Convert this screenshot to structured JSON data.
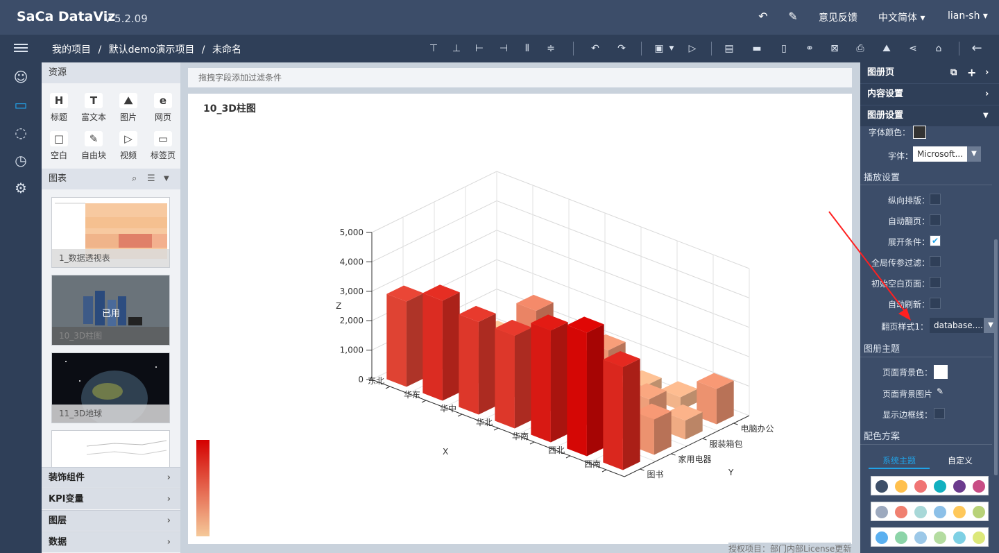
{
  "app": {
    "brand": "SaCa DataViz",
    "version": "V 5.2.09",
    "feedback": "意见反馈",
    "language": "中文简体 ▾",
    "user": "lian-sh ▾"
  },
  "toolbar": {
    "breadcrumb": [
      "我的项目",
      "/",
      "默认demo演示项目",
      "/",
      "未命名"
    ]
  },
  "left_panel": {
    "resources_title": "资源",
    "resources": [
      {
        "icon": "H",
        "label": "标题"
      },
      {
        "icon": "T",
        "label": "富文本"
      },
      {
        "icon": "⛰",
        "label": "图片"
      },
      {
        "icon": "e",
        "label": "网页"
      },
      {
        "icon": "□",
        "label": "空白"
      },
      {
        "icon": "✎",
        "label": "自由块"
      },
      {
        "icon": "▷",
        "label": "视频"
      },
      {
        "icon": "▭",
        "label": "标签页"
      }
    ],
    "charts_title": "图表",
    "thumbnails": [
      {
        "label": "1_数据透视表"
      },
      {
        "label": "10_3D柱图",
        "used_badge": "已用"
      },
      {
        "label": "11_3D地球"
      },
      {
        "label": ""
      }
    ],
    "bottom_sections": [
      "装饰组件",
      "KPI变量",
      "图层",
      "数据"
    ]
  },
  "canvas": {
    "filter_hint": "拖拽字段添加过滤条件",
    "chart_title": "10_3D柱图",
    "license": "授权项目：部门内部License更新"
  },
  "chart_data": {
    "type": "bar3d",
    "zlabel": "Z",
    "xlabel": "X",
    "ylabel": "Y",
    "z_ticks": [
      "5,000",
      "4,000",
      "3,000",
      "2,000",
      "1,000",
      "0"
    ],
    "x_categories": [
      "东北",
      "华东",
      "华中",
      "华北",
      "华南",
      "西北",
      "西南"
    ],
    "y_categories": [
      "电脑办公",
      "服装箱包",
      "家用电器",
      "图书"
    ],
    "zlim": [
      0,
      5000
    ],
    "color_min": "#f5c99a",
    "color_max": "#d40000",
    "values": [
      [
        2900,
        3400,
        3150,
        3150,
        3800,
        4200,
        3500
      ],
      [
        650,
        1200,
        2000,
        2350,
        2150,
        1400,
        1200
      ],
      [
        450,
        650,
        750,
        800,
        600,
        900,
        650
      ],
      [
        150,
        1500,
        300,
        1100,
        350,
        450,
        1200
      ]
    ]
  },
  "right_panel": {
    "sections": {
      "album": "图册页",
      "content": "内容设置",
      "album_settings": "图册设置"
    },
    "font_color_label": "字体颜色：",
    "font_label": "字体：",
    "font_value": "Microsoft...",
    "play_title": "播放设置",
    "play_options": [
      {
        "label": "纵向排版：",
        "checked": false
      },
      {
        "label": "自动翻页：",
        "checked": false
      },
      {
        "label": "展开条件：",
        "checked": true
      },
      {
        "label": "全局传参过滤：",
        "checked": false
      },
      {
        "label": "初始空白页面：",
        "checked": false
      },
      {
        "label": "自动刷新：",
        "checked": false
      }
    ],
    "page_style_label": "翻页样式1：",
    "page_style_value": "database....",
    "theme_title": "图册主题",
    "bg_color_label": "页面背景色：",
    "bg_image_label": "页面背景图片",
    "border_label": "显示边框线：",
    "color_scheme_title": "配色方案",
    "tab_system": "系统主题",
    "tab_custom": "自定义",
    "palettes": [
      [
        "#3d4f68",
        "#ffc04d",
        "#f07474",
        "#11b0c0",
        "#6b3b8e",
        "#c84d85"
      ],
      [
        "#9ca9be",
        "#f08070",
        "#a8d8d8",
        "#8cc0e8",
        "#ffc85a",
        "#b8d278"
      ],
      [
        "#5ab0f0",
        "#8cd4a8",
        "#9cc8e8",
        "#b4dca0",
        "#7ed0e4",
        "#dce87a"
      ]
    ]
  },
  "colors": {
    "topbar": "#3c4d69",
    "toolbar": "#2f3f58",
    "accent": "#20a3e8",
    "annotation_arrow": "#ff2020"
  }
}
